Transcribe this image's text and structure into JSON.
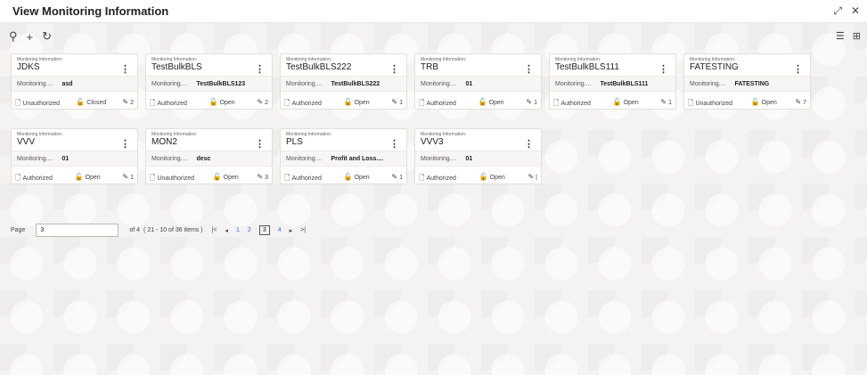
{
  "header": {
    "title": "View Monitoring Information"
  },
  "toolbar": {
    "search_icon": "search-icon",
    "add_icon": "plus-icon",
    "refresh_icon": "refresh-icon"
  },
  "cards": [
    {
      "label": "Monitoring Information:",
      "name": "JDKS",
      "desc_label": "Monitoring....",
      "desc": "asd",
      "auth": "Unauthorized",
      "status": "Closed",
      "count": "2"
    },
    {
      "label": "Monitoring Information:",
      "name": "TestBulkBLS",
      "desc_label": "Monitoring....",
      "desc": "TestBulkBLS123",
      "auth": "Authorized",
      "status": "Open",
      "count": "2"
    },
    {
      "label": "Monitoring Information:",
      "name": "TestBulkBLS222",
      "desc_label": "Monitoring....",
      "desc": "TestBulkBLS222",
      "auth": "Authorized",
      "status": "Open",
      "count": "1"
    },
    {
      "label": "Monitoring Information:",
      "name": "TRB",
      "desc_label": "Monitoring....",
      "desc": "01",
      "auth": "Authorized",
      "status": "Open",
      "count": "1"
    },
    {
      "label": "Monitoring Information:",
      "name": "TestBulkBLS111",
      "desc_label": "Monitoring....",
      "desc": "TestBulkBLS111",
      "auth": "Authorized",
      "status": "Open",
      "count": "1"
    },
    {
      "label": "Monitoring Information:",
      "name": "FATESTING",
      "desc_label": "Monitoring....",
      "desc": "FATESTING",
      "auth": "Unauthorized",
      "status": "Open",
      "count": "7"
    },
    {
      "label": "Monitoring Information:",
      "name": "VVV",
      "desc_label": "Monitoring....",
      "desc": "01",
      "auth": "Authorized",
      "status": "Open",
      "count": "1"
    },
    {
      "label": "Monitoring Information:",
      "name": "MON2",
      "desc_label": "Monitoring....",
      "desc": "desc",
      "auth": "Unauthorized",
      "status": "Open",
      "count": "3"
    },
    {
      "label": "Monitoring Information:",
      "name": "PLS",
      "desc_label": "Monitoring....",
      "desc": "Profit and Loss....",
      "auth": "Authorized",
      "status": "Open",
      "count": "1"
    },
    {
      "label": "Monitoring Information:",
      "name": "VVV3",
      "desc_label": "Monitoring....",
      "desc": "01",
      "auth": "Authorized",
      "status": "Open",
      "count": "|"
    }
  ],
  "pagination": {
    "page_label": "Page",
    "page_value": "3",
    "of_text": "of 4",
    "items_text": "( 21 - 10 of 36 items )",
    "pages": [
      "1",
      "2",
      "3",
      "4"
    ],
    "current": "3"
  }
}
